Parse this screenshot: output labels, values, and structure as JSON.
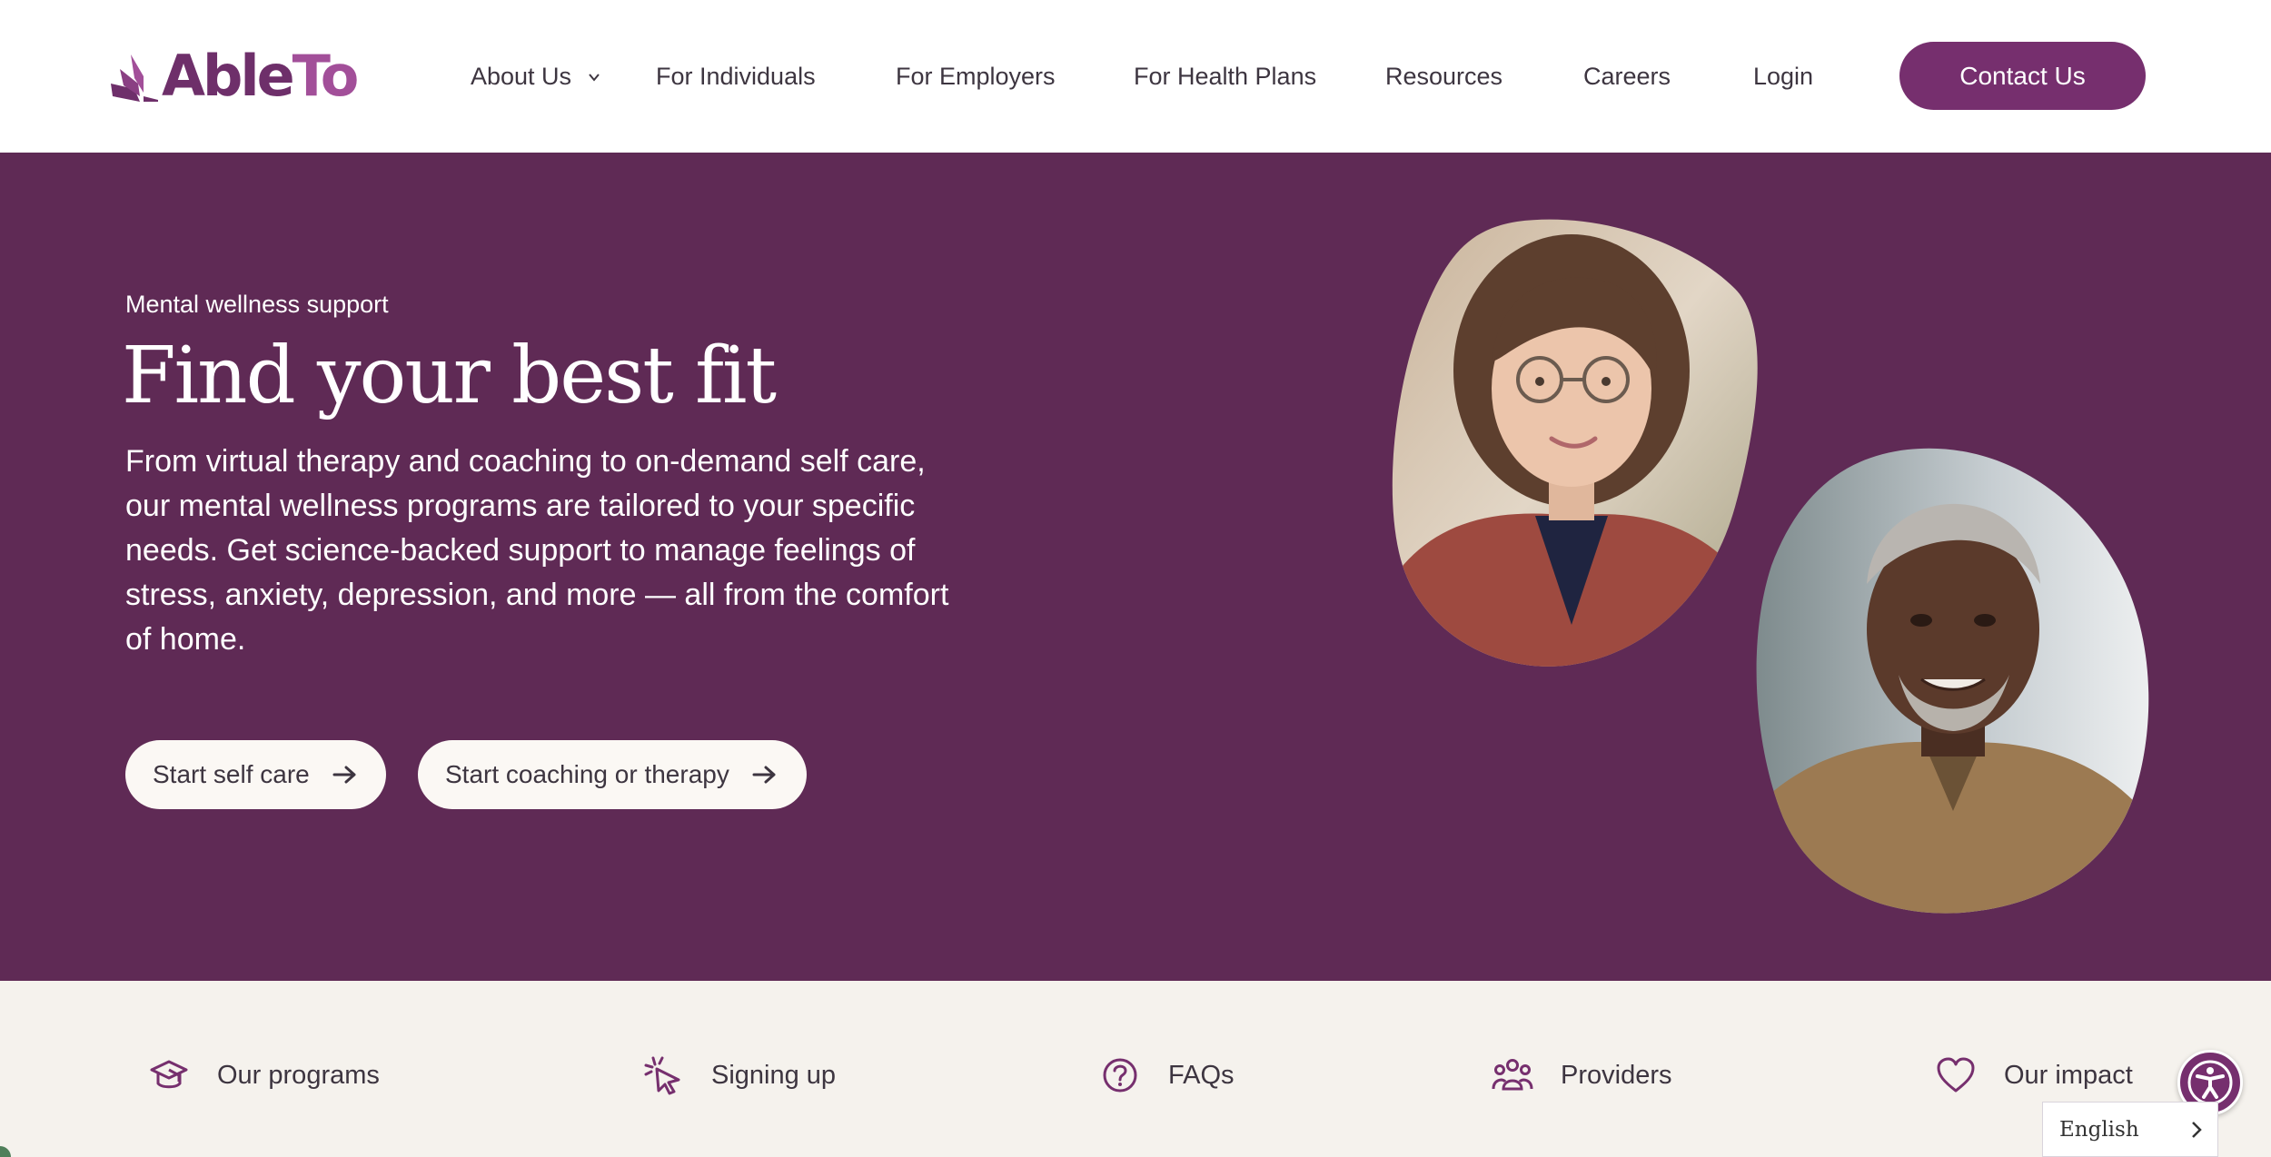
{
  "header": {
    "logo": {
      "text_able": "Able",
      "text_to": "To"
    },
    "nav": [
      {
        "label": "About Us",
        "has_dropdown": true
      },
      {
        "label": "For Individuals"
      },
      {
        "label": "For Employers"
      },
      {
        "label": "For Health Plans"
      },
      {
        "label": "Resources"
      },
      {
        "label": "Careers"
      },
      {
        "label": "Login"
      }
    ],
    "contact_label": "Contact Us"
  },
  "hero": {
    "eyebrow": "Mental wellness support",
    "title": "Find your best fit",
    "body": "From virtual therapy and coaching to on-demand self care, our mental wellness programs are tailored to your specific needs. Get science-backed support to manage feelings of stress, anxiety, depression, and more — all from the comfort of home.",
    "buttons": [
      {
        "label": "Start self care",
        "icon": "arrow-right-icon"
      },
      {
        "label": "Start coaching or therapy",
        "icon": "arrow-right-icon"
      }
    ],
    "images": [
      {
        "name": "woman-portrait-photo"
      },
      {
        "name": "man-portrait-photo"
      }
    ]
  },
  "subnav": {
    "items": [
      {
        "label": "Our programs",
        "icon": "graduation-cap-icon"
      },
      {
        "label": "Signing up",
        "icon": "cursor-click-icon"
      },
      {
        "label": "FAQs",
        "icon": "question-circle-icon"
      },
      {
        "label": "Providers",
        "icon": "people-group-icon"
      },
      {
        "label": "Our impact",
        "icon": "heart-icon"
      }
    ]
  },
  "widgets": {
    "accessibility_icon": "accessibility-icon",
    "language": "English"
  },
  "colors": {
    "brand_purple": "#762f6e",
    "hero_background": "#5f2a55",
    "subnav_background": "#f5f2ed",
    "logo_light": "#a24f99"
  }
}
